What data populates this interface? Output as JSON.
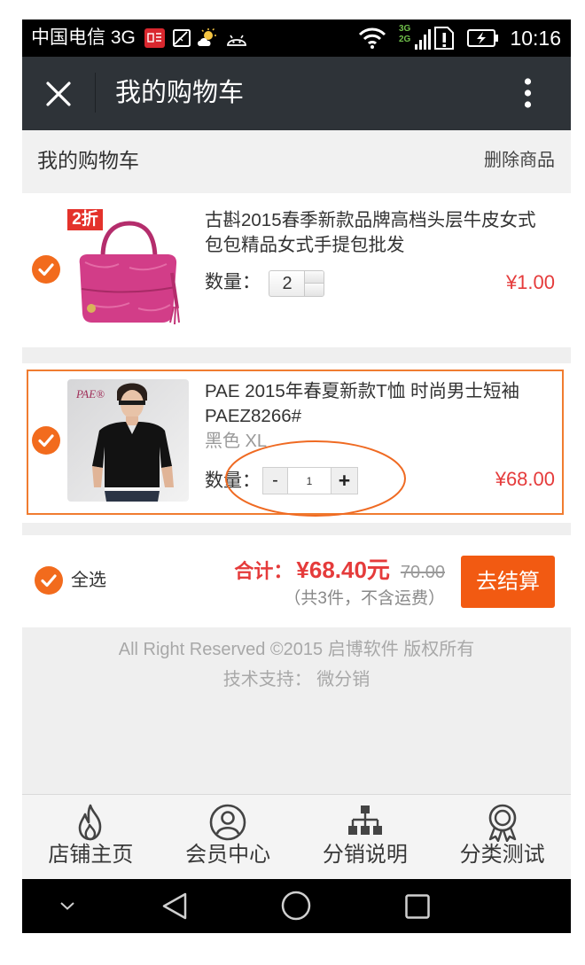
{
  "status_bar": {
    "carrier": "中国电信 3G",
    "network_primary": "3G",
    "network_secondary": "2G",
    "time": "10:16",
    "left_icons": [
      "news-notification-icon",
      "gallery-icon",
      "weather-icon",
      "android-icon"
    ],
    "right_icons": [
      "wifi-icon",
      "signal-icon",
      "sim-alert-icon",
      "battery-charging-icon"
    ]
  },
  "title_bar": {
    "title": "我的购物车",
    "left_icon": "close-icon",
    "right_icon": "more-vertical-icon"
  },
  "cart_header": {
    "title": "我的购物车",
    "delete_label": "删除商品"
  },
  "items": [
    {
      "checked": true,
      "discount_badge": "2折",
      "title": "古斟2015春季新款品牌高档头层牛皮女式包包精品女式手提包批发",
      "quantity_label": "数量：",
      "quantity": "2",
      "price": "¥1.00"
    },
    {
      "checked": true,
      "image_logo": "PAE®",
      "title": "PAE 2015年春夏新款T恤 时尚男士短袖 PAEZ8266#",
      "variant": "黑色 XL",
      "quantity_label": "数量：",
      "decrement_label": "-",
      "quantity": "1",
      "increment_label": "+",
      "price": "¥68.00"
    }
  ],
  "summary": {
    "select_all_checked": true,
    "select_all_label": "全选",
    "total_label": "合计：",
    "total": "¥68.40元",
    "original_total": "70.00",
    "note": "（共3件，不含运费）",
    "checkout_label": "去结算"
  },
  "footer": {
    "copyright": "All Right Reserved ©2015 启博软件 版权所有",
    "support": "技术支持： 微分销"
  },
  "bottom_nav": [
    {
      "label": "店铺主页",
      "icon": "flame-icon"
    },
    {
      "label": "会员中心",
      "icon": "user-circle-icon"
    },
    {
      "label": "分销说明",
      "icon": "org-chart-icon"
    },
    {
      "label": "分类测试",
      "icon": "award-icon"
    }
  ],
  "system_nav": {
    "icons": [
      "chevron-down-icon",
      "back-icon",
      "home-icon",
      "recents-icon"
    ]
  },
  "colors": {
    "accent": "#f26b1d",
    "price": "#e53b3b",
    "title_bar": "#2e3338",
    "checkout_button": "#f25a12"
  }
}
